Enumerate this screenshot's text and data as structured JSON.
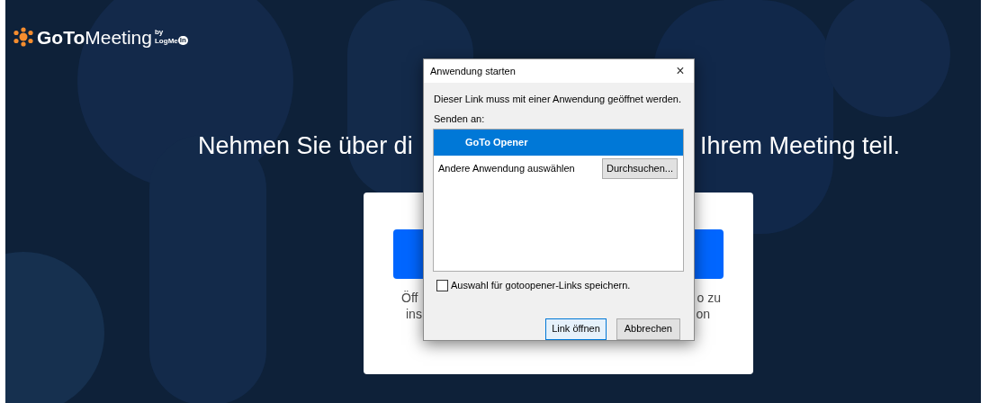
{
  "logo": {
    "brand_bold": "GoTo",
    "brand_light": "Meeting",
    "by": "by",
    "maker": "LogMe",
    "maker_badge": "In"
  },
  "headline": {
    "left_fragment": "Nehmen Sie über di",
    "right_fragment": "Ihrem Meeting teil."
  },
  "card": {
    "lines": [
      {
        "left": "Öff",
        "right": "o zu"
      },
      {
        "left": "ins",
        "right": "on"
      }
    ]
  },
  "dialog": {
    "title": "Anwendung starten",
    "close": "×",
    "message": "Dieser Link muss mit einer Anwendung geöffnet werden.",
    "send_to": "Senden an:",
    "apps": [
      {
        "kind": "app",
        "label": "GoTo Opener",
        "selected": true
      },
      {
        "kind": "other",
        "label": "Andere Anwendung auswählen",
        "selected": false,
        "button": "Durchsuchen..."
      }
    ],
    "remember": {
      "label": "Auswahl für gotoopener-Links speichern.",
      "checked": false
    },
    "buttons": [
      {
        "label": "Link öffnen",
        "default": true
      },
      {
        "label": "Abbrechen",
        "default": false
      }
    ]
  }
}
